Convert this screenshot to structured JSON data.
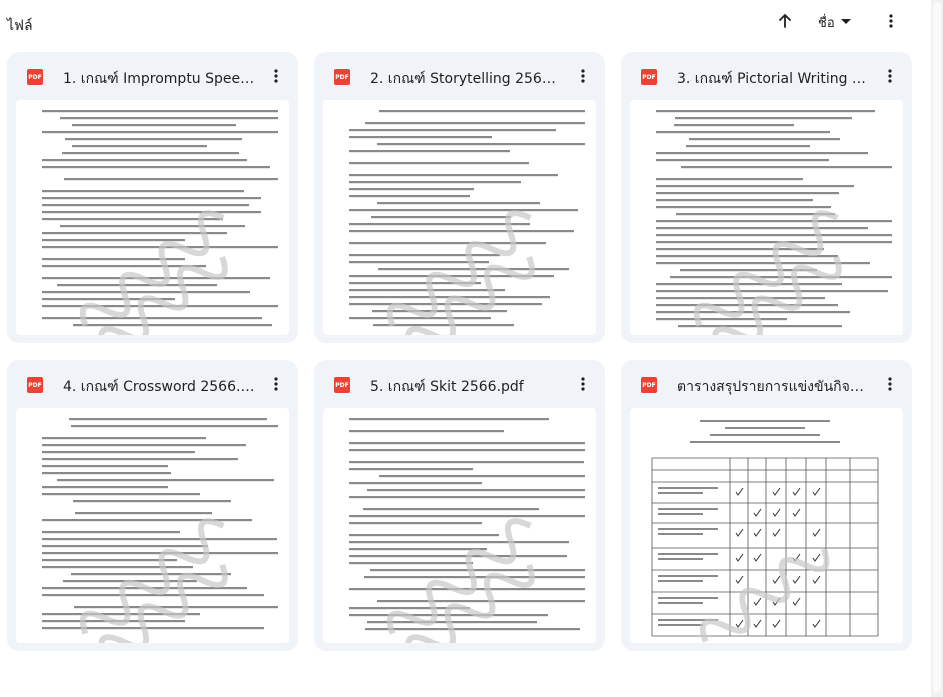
{
  "header": {
    "title": "ไฟล์",
    "sort_label": "ชื่อ",
    "sort_direction_icon": "arrow-up-icon",
    "more_icon": "more-vert-icon"
  },
  "colors": {
    "card_bg": "#f0f4f9",
    "pdf_red": "#ea4335",
    "watermark": "#c8c8c8"
  },
  "files": [
    {
      "name": "1. เกณฑ์ Impromptu Speec...",
      "type_badge": "PDF",
      "thumb": "text"
    },
    {
      "name": "2. เกณฑ์ Storytelling 2566....",
      "type_badge": "PDF",
      "thumb": "text"
    },
    {
      "name": "3. เกณฑ์ Pictorial Writing 2...",
      "type_badge": "PDF",
      "thumb": "text"
    },
    {
      "name": "4. เกณฑ์ Crossword 2566.p...",
      "type_badge": "PDF",
      "thumb": "text"
    },
    {
      "name": "5. เกณฑ์ Skit 2566.pdf",
      "type_badge": "PDF",
      "thumb": "text"
    },
    {
      "name": "ตารางสรุปรายการแข่งขันกิจกร...",
      "type_badge": "PDF",
      "thumb": "table"
    }
  ]
}
